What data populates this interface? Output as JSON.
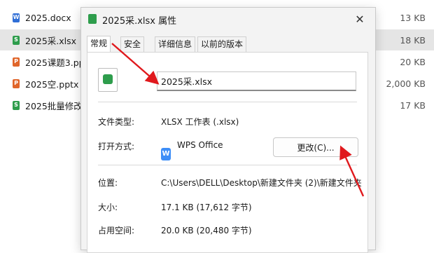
{
  "files": [
    {
      "name": "2025.docx",
      "size": "13 KB",
      "icon": "docx-icon",
      "selected": false
    },
    {
      "name": "2025采.xlsx",
      "size": "18 KB",
      "icon": "xlsx-icon",
      "selected": true
    },
    {
      "name": "2025课题3.ppt",
      "size": "20 KB",
      "icon": "pptx-icon",
      "selected": false
    },
    {
      "name": "2025空.pptx",
      "size": "2,000 KB",
      "icon": "pptx-icon",
      "selected": false
    },
    {
      "name": "2025批量修改",
      "size": "17 KB",
      "icon": "xlsx-icon",
      "selected": false
    }
  ],
  "dialog": {
    "title": "2025采.xlsx 属性",
    "close_glyph": "✕",
    "tabs": [
      "常规",
      "安全",
      "详细信息",
      "以前的版本"
    ],
    "active_tab": 0,
    "file_name_value": "2025采.xlsx",
    "file_type_label": "文件类型:",
    "file_type_value": "XLSX 工作表 (.xlsx)",
    "open_with_label": "打开方式:",
    "open_with_app": "WPS Office",
    "change_button": "更改(C)...",
    "location_label": "位置:",
    "location_value": "C:\\Users\\DELL\\Desktop\\新建文件夹 (2)\\新建文件夹",
    "size_label": "大小:",
    "size_value": "17.1 KB (17,612 字节)",
    "disk_size_label": "占用空间:",
    "disk_size_value": "20.0 KB (20,480 字节)"
  },
  "colors": {
    "accent_arrow": "#e0191d",
    "xlsx_green": "#2e9d4c",
    "docx_blue": "#2f6ed6",
    "pptx_orange": "#e0652a",
    "wps_blue": "#3e8ef7"
  }
}
